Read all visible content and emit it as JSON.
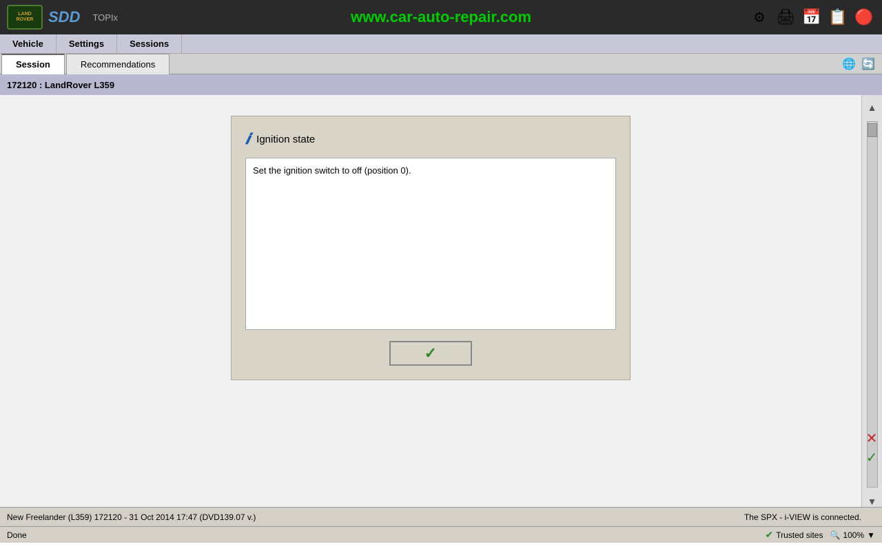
{
  "toolbar": {
    "logo_text": "LAND\nROVER",
    "sdd_label": "SDD",
    "topix_label": "TOPIx",
    "website_url": "www.car-auto-repair.com",
    "icons": [
      "gear",
      "print",
      "calendar",
      "note",
      "power"
    ]
  },
  "nav": {
    "tabs": [
      {
        "label": "Session",
        "active": true
      },
      {
        "label": "Recommendations",
        "active": false
      }
    ],
    "sub_items": [
      {
        "label": "Vehicle"
      },
      {
        "label": "Settings"
      },
      {
        "label": "Sessions"
      }
    ]
  },
  "breadcrumb": {
    "text": "172120 : LandRover L359"
  },
  "dialog": {
    "title": "Ignition state",
    "content": "Set the ignition switch to off (position 0).",
    "confirm_icon": "✓"
  },
  "status_bar": {
    "left_text": "New Freelander (L359) 172120 - 31 Oct 2014 17:47 (DVD139.07 v.)",
    "spx_status": "The SPX - i-VIEW is connected."
  },
  "browser_status": {
    "done_text": "Done",
    "trusted_sites_label": "Trusted sites",
    "zoom_level": "100%"
  }
}
